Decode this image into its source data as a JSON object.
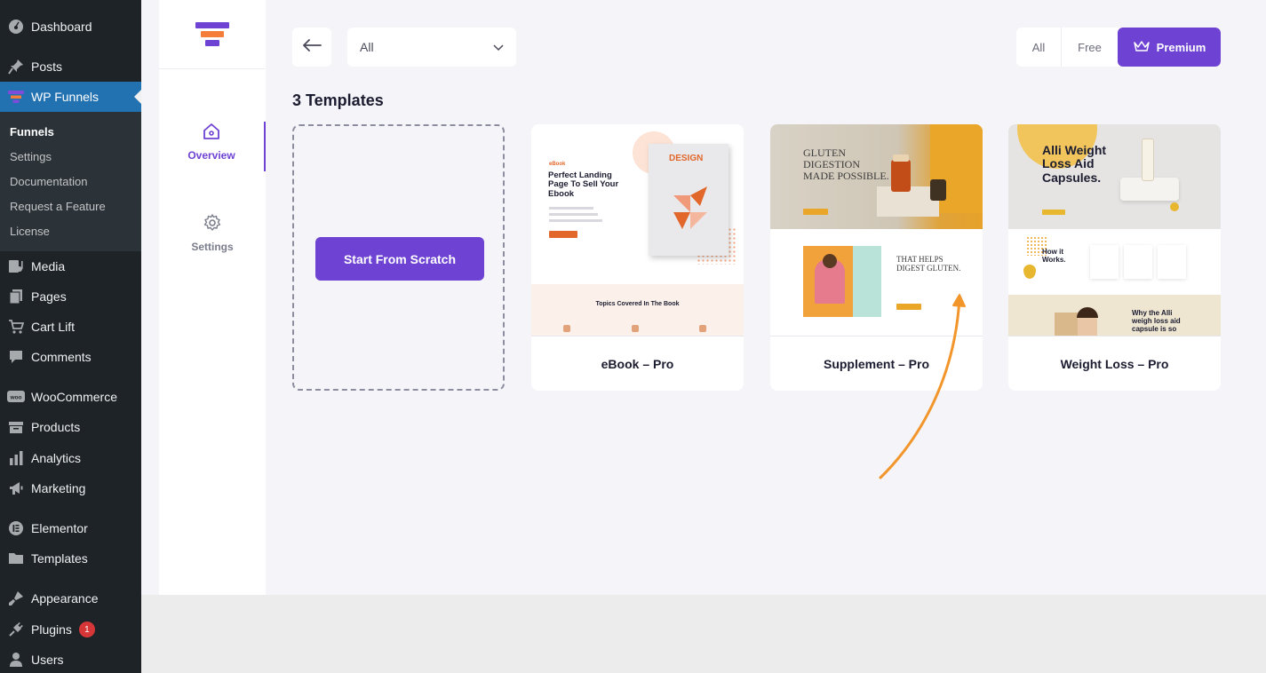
{
  "wp_menu": {
    "items": [
      {
        "label": "Dashboard",
        "icon": "gauge-icon"
      },
      {
        "label": "Posts",
        "icon": "pin-icon"
      },
      {
        "label": "WP Funnels",
        "icon": "funnel-icon"
      },
      {
        "label": "Media",
        "icon": "media-icon"
      },
      {
        "label": "Pages",
        "icon": "pages-icon"
      },
      {
        "label": "Cart Lift",
        "icon": "cart-icon"
      },
      {
        "label": "Comments",
        "icon": "comment-icon"
      },
      {
        "label": "WooCommerce",
        "icon": "woo-icon"
      },
      {
        "label": "Products",
        "icon": "box-icon"
      },
      {
        "label": "Analytics",
        "icon": "bar-chart-icon"
      },
      {
        "label": "Marketing",
        "icon": "megaphone-icon"
      },
      {
        "label": "Elementor",
        "icon": "elementor-icon"
      },
      {
        "label": "Templates",
        "icon": "folder-icon"
      },
      {
        "label": "Appearance",
        "icon": "brush-icon"
      },
      {
        "label": "Plugins",
        "icon": "plug-icon",
        "badge": "1"
      },
      {
        "label": "Users",
        "icon": "user-icon"
      }
    ],
    "submenu": [
      "Funnels",
      "Settings",
      "Documentation",
      "Request a Feature",
      "License"
    ]
  },
  "plugin_nav": {
    "overview": "Overview",
    "settings": "Settings"
  },
  "toolbar": {
    "category_value": "All",
    "filters": [
      "All",
      "Free",
      "Premium"
    ],
    "active_filter": "Premium"
  },
  "templates": {
    "count_title": "3 Templates",
    "scratch_label": "Start From Scratch",
    "cards": [
      {
        "name": "eBook – Pro",
        "preview": {
          "badge": "eBook",
          "headline": "Perfect Landing Page To Sell Your Ebook",
          "book_title": "DESIGN",
          "section": "Topics Covered In The Book"
        }
      },
      {
        "name": "Supplement – Pro",
        "preview": {
          "headline": "GLUTEN DIGESTION MADE POSSIBLE.",
          "subhead": "THAT HELPS DIGEST GLUTEN."
        }
      },
      {
        "name": "Weight Loss – Pro",
        "preview": {
          "headline": "Alli Weight Loss Aid Capsules.",
          "how": "How it Works.",
          "why": "Why the Alli weigh loss aid capsule is so"
        }
      }
    ]
  },
  "colors": {
    "accent": "#6e42d3",
    "wp_sidebar": "#1d2327",
    "wp_active": "#2271b1",
    "arrow": "#f2962c"
  }
}
